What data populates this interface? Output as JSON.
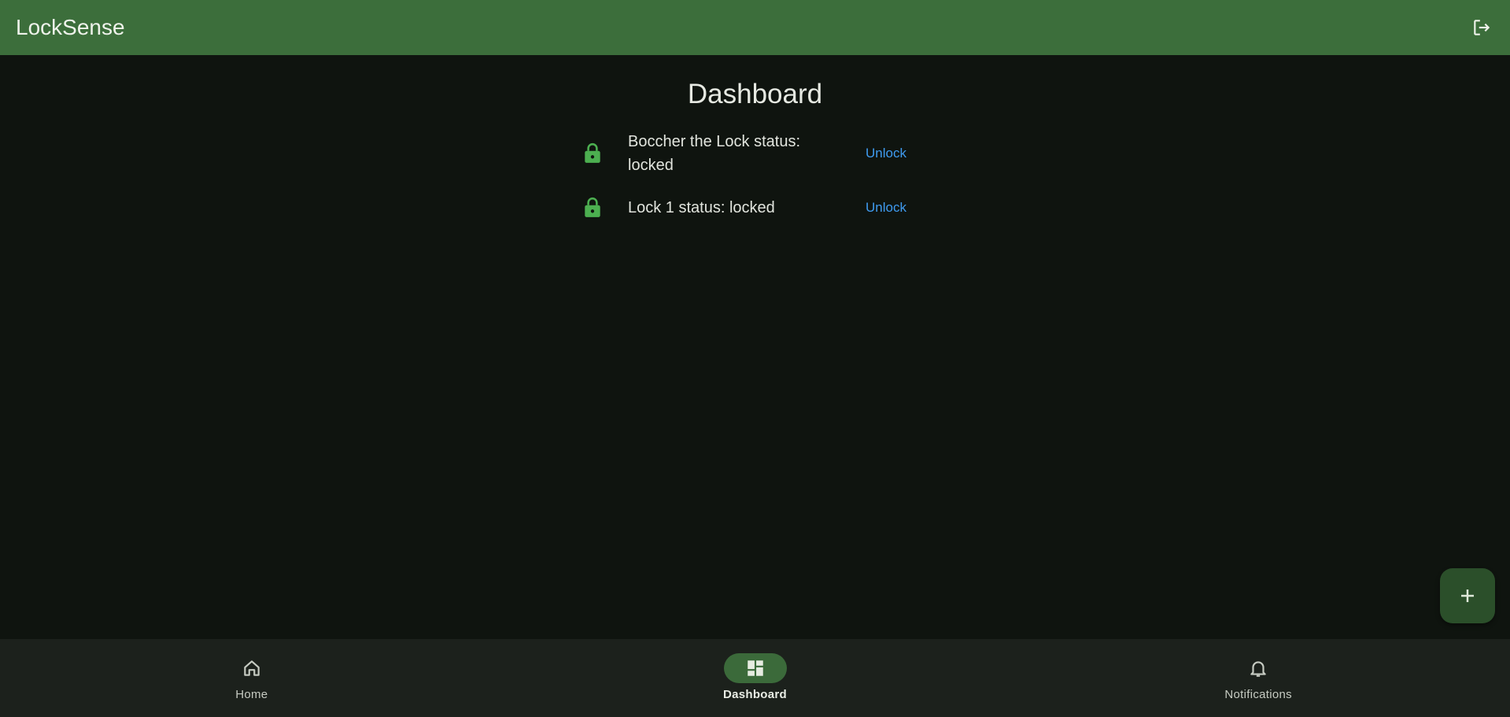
{
  "app": {
    "title": "LockSense"
  },
  "header": {
    "logout_icon": "logout-icon"
  },
  "main": {
    "page_title": "Dashboard",
    "locks": [
      {
        "status_text": "Boccher the Lock status: locked",
        "action_label": "Unlock",
        "icon": "lock-icon"
      },
      {
        "status_text": "Lock 1 status: locked",
        "action_label": "Unlock",
        "icon": "lock-icon"
      }
    ]
  },
  "fab": {
    "icon": "plus-icon"
  },
  "bottom_nav": {
    "items": [
      {
        "label": "Home",
        "icon": "home-icon",
        "active": false
      },
      {
        "label": "Dashboard",
        "icon": "dashboard-icon",
        "active": true
      },
      {
        "label": "Notifications",
        "icon": "bell-icon",
        "active": false
      }
    ]
  },
  "colors": {
    "app_bar": "#3c6e3b",
    "background": "#0f140f",
    "lock_icon": "#4caf50",
    "link": "#3f9bf0",
    "fab": "#2b4f2a",
    "nav_active_pill": "#3b6a3a"
  }
}
